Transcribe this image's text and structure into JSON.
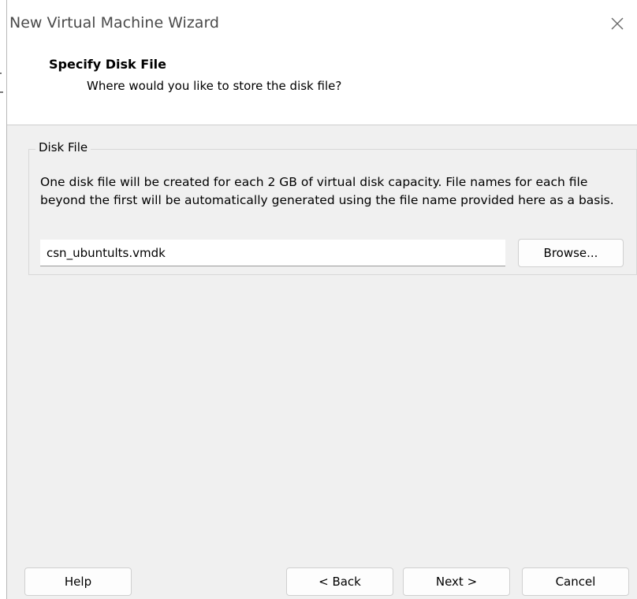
{
  "window": {
    "title": "New Virtual Machine Wizard"
  },
  "header": {
    "title": "Specify Disk File",
    "subtitle": "Where would you like to store the disk file?"
  },
  "disk_file_group": {
    "legend": "Disk File",
    "description": "One disk file will be created for each 2 GB of virtual disk capacity. File names for each file beyond the first will be automatically generated using the file name provided here as a basis.",
    "filename_value": "csn_ubuntults.vmdk",
    "browse_label": "Browse..."
  },
  "footer": {
    "help_label": "Help",
    "back_label": "< Back",
    "next_label": "Next >",
    "cancel_label": "Cancel"
  },
  "icons": {
    "close": "close-icon"
  }
}
